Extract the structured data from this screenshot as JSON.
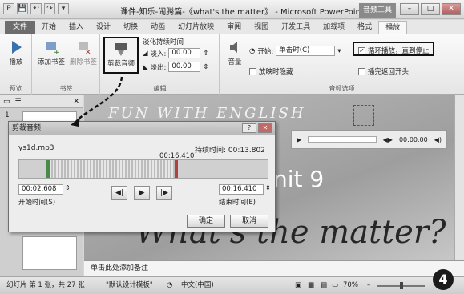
{
  "window": {
    "title": "课件-知乐-闹腾篇-《what's the matter》 - Microsoft PowerPoint",
    "context_tab": "音频工具",
    "qat": [
      "P",
      "💾",
      "↶",
      "↷",
      "▾"
    ],
    "controls": [
      "–",
      "□",
      "✕"
    ]
  },
  "tabs": [
    {
      "label": "文件",
      "kind": "file"
    },
    {
      "label": "开始"
    },
    {
      "label": "插入"
    },
    {
      "label": "设计"
    },
    {
      "label": "切换"
    },
    {
      "label": "动画"
    },
    {
      "label": "幻灯片放映"
    },
    {
      "label": "审阅"
    },
    {
      "label": "视图"
    },
    {
      "label": "开发工具"
    },
    {
      "label": "加载项"
    },
    {
      "label": "格式"
    },
    {
      "label": "播放",
      "kind": "active"
    }
  ],
  "ribbon": {
    "preview": {
      "play": "播放",
      "group": "预览"
    },
    "bookmarks": {
      "add": "添加书签",
      "remove": "删除书签",
      "group": "书签"
    },
    "editing": {
      "trim": "剪裁音频",
      "fade_title": "淡化持续时间",
      "fade_in_label": "淡入:",
      "fade_in": "00.00",
      "fade_out_label": "淡出:",
      "fade_out": "00.00",
      "group": "编辑"
    },
    "audio_options": {
      "volume": "音量",
      "start_label": "开始:",
      "start_value": "单击时(C)",
      "hide": "放映时隐藏",
      "loop": "循环播放，直到停止",
      "rewind": "播完返回开头",
      "group": "音频选项"
    }
  },
  "leftpane": {
    "slide_no": "1",
    "tab_close": "✕"
  },
  "slide": {
    "banner": "FUN WITH ENGLISH",
    "unit": "nit 9",
    "subtitle": "What's the matter?",
    "player_time": "00:00.00"
  },
  "dialog": {
    "title": "剪裁音频",
    "filename": "ys1d.mp3",
    "duration_label": "持续时间:",
    "duration": "00:13.802",
    "marker_time": "00:16.410",
    "start_time": "00:02.608",
    "start_label": "开始时间(S)",
    "end_time": "00:16.410",
    "end_label": "结束时间(E)",
    "ok": "确定",
    "cancel": "取消"
  },
  "notes": {
    "placeholder": "单击此处添加备注"
  },
  "status": {
    "slide_info": "幻灯片 第 1 张，共 27 张",
    "theme": "\"默认设计模板\"",
    "lang": "中文(中国)",
    "zoom": "70%"
  },
  "step_badge": "4",
  "colors": {
    "highlight_border": "#111111",
    "dialog_bg": "#ededed",
    "file_tab": "#6d6d6d"
  }
}
